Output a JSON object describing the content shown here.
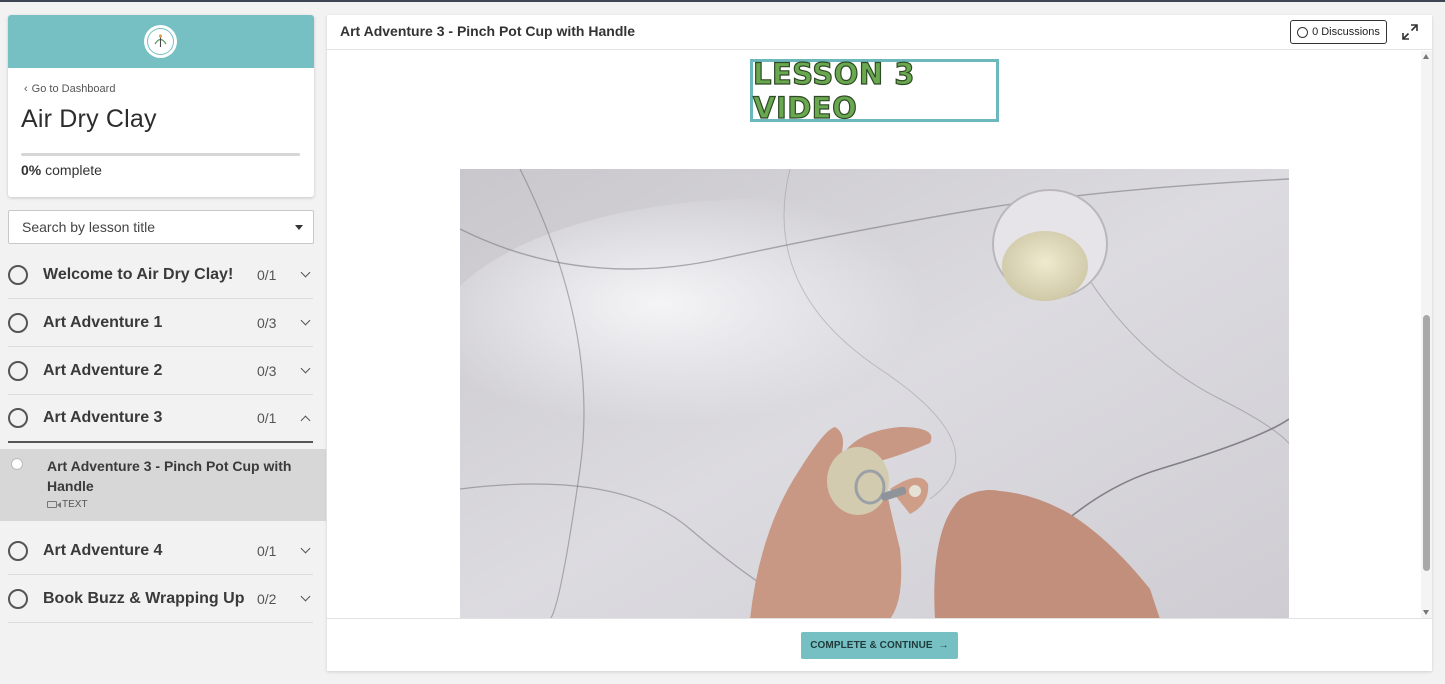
{
  "sidebar": {
    "back_label": "Go to Dashboard",
    "course_title": "Air Dry Clay",
    "progress": {
      "percent_label": "0%",
      "suffix": "complete",
      "value": 0
    },
    "search_placeholder": "Search by lesson title",
    "chapters": [
      {
        "name": "Welcome to Air Dry Clay!",
        "count": "0/1",
        "expanded": false
      },
      {
        "name": "Art Adventure 1",
        "count": "0/3",
        "expanded": false
      },
      {
        "name": "Art Adventure 2",
        "count": "0/3",
        "expanded": false
      },
      {
        "name": "Art Adventure 3",
        "count": "0/1",
        "expanded": true
      },
      {
        "name": "Art Adventure 4",
        "count": "0/1",
        "expanded": false
      },
      {
        "name": "Book Buzz & Wrapping Up",
        "count": "0/2",
        "expanded": false
      }
    ],
    "active_lesson": {
      "title": "Art Adventure 3 - Pinch Pot Cup with Handle",
      "type": "TEXT"
    }
  },
  "main": {
    "title": "Art Adventure 3 - Pinch Pot Cup with Handle",
    "discussions_label": "0 Discussions",
    "banner_text": "LESSON 3 VIDEO",
    "complete_button": "COMPLETE & CONTINUE",
    "complete_arrow": "→"
  },
  "colors": {
    "accent": "#76bfc2",
    "banner_green": "#6aa84f",
    "active_lesson_bg": "#d7d7d7"
  }
}
